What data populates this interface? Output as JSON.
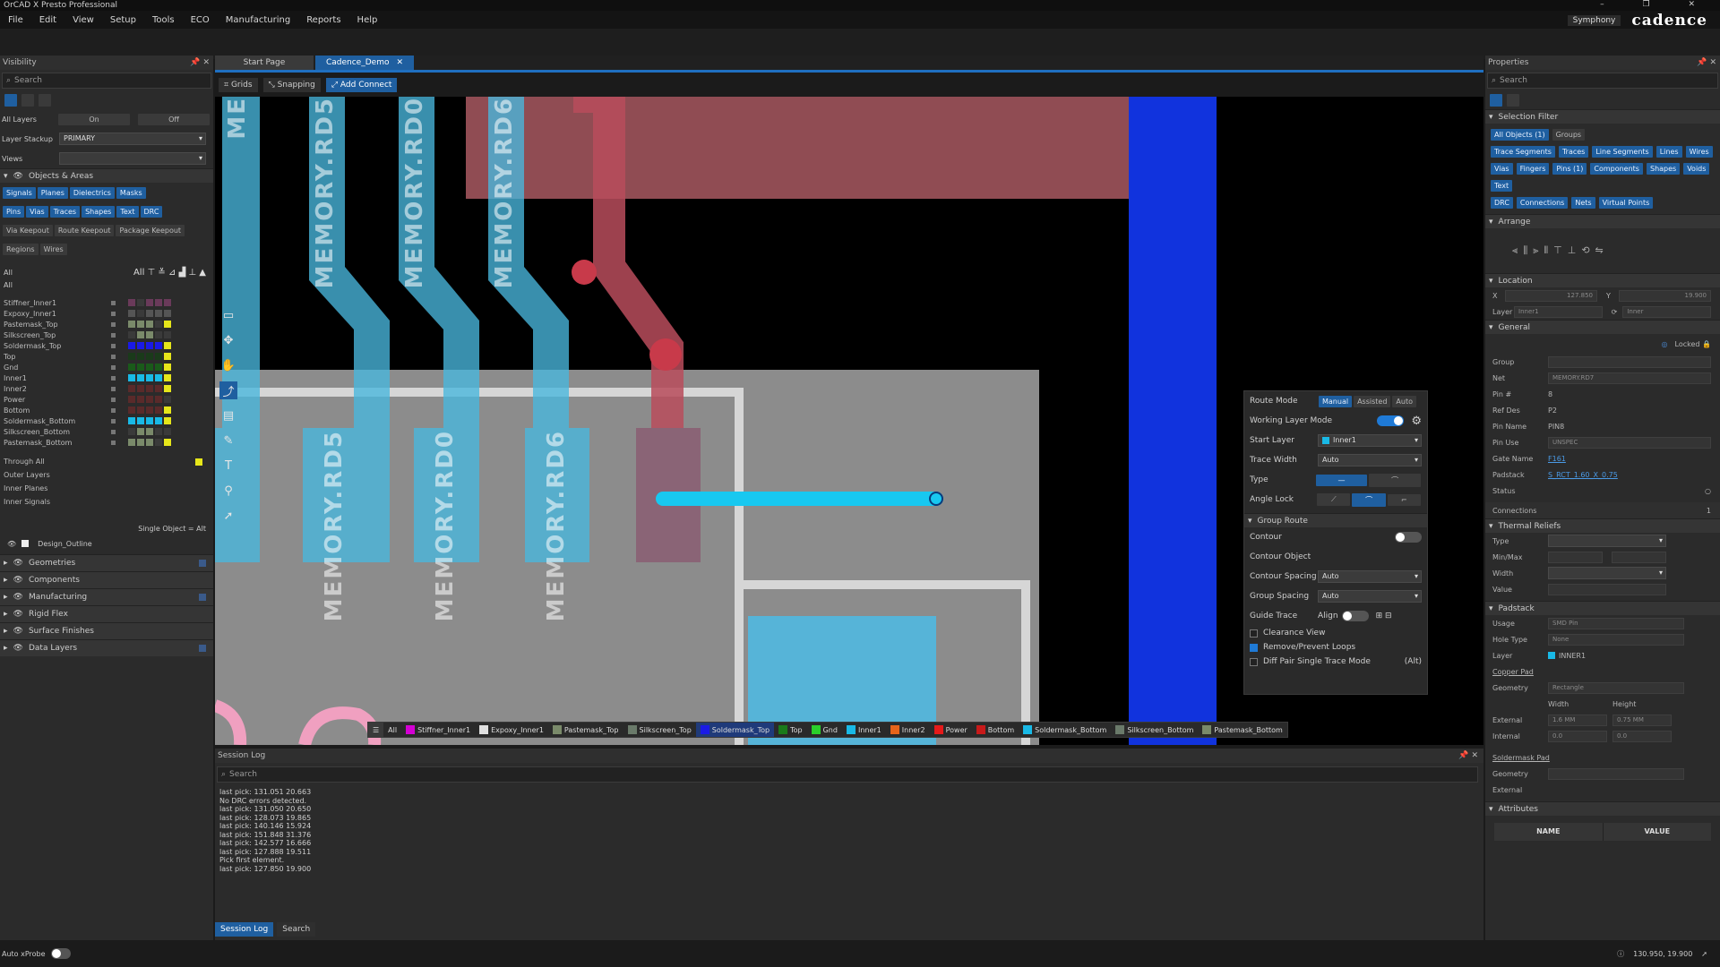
{
  "app": {
    "title": "OrCAD X Presto Professional"
  },
  "menu": [
    "File",
    "Edit",
    "View",
    "Setup",
    "Tools",
    "ECO",
    "Manufacturing",
    "Reports",
    "Help"
  ],
  "brand": {
    "symphony": "Symphony",
    "logo": "cadence"
  },
  "tabs": {
    "start": "Start Page",
    "design": "Cadence_Demo"
  },
  "toolbar": {
    "grids": "Grids",
    "snapping": "Snapping",
    "add_connect": "Add Connect"
  },
  "visibility": {
    "title": "Visibility",
    "search": "Search",
    "all_layers": "All Layers",
    "on": "On",
    "off": "Off",
    "layer_stackup_label": "Layer Stackup",
    "layer_stackup_value": "PRIMARY",
    "views_label": "Views",
    "objects_areas": "Objects & Areas",
    "groups1": [
      "Signals",
      "Planes",
      "Dielectrics",
      "Masks"
    ],
    "groups2": [
      "Pins",
      "Vias",
      "Traces",
      "Shapes",
      "Text",
      "DRC"
    ],
    "groups3": [
      "Via Keepout",
      "Route Keepout",
      "Package Keepout"
    ],
    "groups4": [
      "Regions",
      "Wires"
    ],
    "all": "All",
    "layers": [
      "Stiffner_Inner1",
      "Expoxy_Inner1",
      "Pastemask_Top",
      "Silkscreen_Top",
      "Soldermask_Top",
      "Top",
      "Gnd",
      "Inner1",
      "Inner2",
      "Power",
      "Bottom",
      "Soldermask_Bottom",
      "Silkscreen_Bottom",
      "Pastemask_Bottom"
    ],
    "extra": [
      "Through All",
      "Outer Layers",
      "Inner Planes",
      "Inner Signals"
    ],
    "single_object": "Single Object = Alt",
    "design_outline": "Design_Outline",
    "sections": [
      "Geometries",
      "Components",
      "Manufacturing",
      "Rigid Flex",
      "Surface Finishes",
      "Data Layers"
    ]
  },
  "canvas": {
    "labels": [
      "MEMORY.RD5",
      "MEMORY.RD0",
      "MEMORY.RD6",
      "MEMORY.RD5",
      "MEMORY.RD0",
      "MEMORY.RD6",
      "ME"
    ]
  },
  "route_panel": {
    "route_mode": "Route Mode",
    "modes": [
      "Manual",
      "Assisted",
      "Auto"
    ],
    "working_layer_mode": "Working Layer Mode",
    "start_layer": "Start Layer",
    "start_layer_value": "Inner1",
    "trace_width": "Trace Width",
    "trace_width_value": "Auto",
    "type": "Type",
    "angle_lock": "Angle Lock",
    "group_route": "Group Route",
    "contour": "Contour",
    "contour_object": "Contour Object",
    "contour_spacing": "Contour Spacing",
    "contour_spacing_value": "Auto",
    "group_spacing": "Group Spacing",
    "group_spacing_value": "Auto",
    "guide_trace": "Guide Trace",
    "align": "Align",
    "clearance_view": "Clearance View",
    "remove_loops": "Remove/Prevent Loops",
    "diff_pair": "Diff Pair Single Trace Mode",
    "alt": "(Alt)"
  },
  "layer_bar": {
    "all": "All",
    "items": [
      {
        "name": "Stiffner_Inner1",
        "color": "#d400d4"
      },
      {
        "name": "Expoxy_Inner1",
        "color": "#e0e0e0"
      },
      {
        "name": "Pastemask_Top",
        "color": "#7a8a6a"
      },
      {
        "name": "Silkscreen_Top",
        "color": "#6a7a6a"
      },
      {
        "name": "Soldermask_Top",
        "color": "#1a1ae6"
      },
      {
        "name": "Top",
        "color": "#1a7a1a"
      },
      {
        "name": "Gnd",
        "color": "#2acf2a"
      },
      {
        "name": "Inner1",
        "color": "#19b9e6"
      },
      {
        "name": "Inner2",
        "color": "#e6641a"
      },
      {
        "name": "Power",
        "color": "#e61a1a"
      },
      {
        "name": "Bottom",
        "color": "#c81a1a"
      },
      {
        "name": "Soldermask_Bottom",
        "color": "#19b9e6"
      },
      {
        "name": "Silkscreen_Bottom",
        "color": "#6a7a6a"
      },
      {
        "name": "Pastemask_Bottom",
        "color": "#7a8a6a"
      }
    ]
  },
  "session_log": {
    "title": "Session Log",
    "search": "Search",
    "lines": [
      "last pick: 131.051 20.663",
      "No DRC errors detected.",
      "last pick: 131.050 20.650",
      "last pick: 128.073 19.865",
      "last pick: 140.146 15.924",
      "last pick: 151.848 31.376",
      "last pick: 142.577 16.666",
      "last pick: 127.888 19.511",
      "Pick first element.",
      "last pick: 127.850 19.900"
    ],
    "tab_log": "Session Log",
    "tab_search": "Search"
  },
  "status": {
    "auto_xprobe": "Auto xProbe",
    "coords": "130.950, 19.900"
  },
  "properties": {
    "title": "Properties",
    "search": "Search",
    "selection_filter": "Selection Filter",
    "filters": [
      "All Objects (1)",
      "Groups",
      "Trace Segments",
      "Traces",
      "Line Segments",
      "Lines",
      "Wires",
      "Vias",
      "Fingers",
      "Pins (1)",
      "Components",
      "Shapes",
      "Voids",
      "Text",
      "DRC",
      "Connections",
      "Nets",
      "Virtual Points"
    ],
    "arrange": "Arrange",
    "location": "Location",
    "x": "X",
    "x_val": "127.850",
    "y": "Y",
    "y_val": "19.900",
    "layer": "Layer",
    "layer_val": "Inner1",
    "layer_val2": "Inner",
    "general": "General",
    "locked": "Locked",
    "group": "Group",
    "net": "Net",
    "net_val": "MEMORY.RD7",
    "pin_no": "Pin #",
    "pin_no_val": "8",
    "ref_des": "Ref Des",
    "ref_des_val": "P2",
    "pin_name": "Pin Name",
    "pin_name_val": "PIN8",
    "pin_use": "Pin Use",
    "pin_use_val": "UNSPEC",
    "gate_name": "Gate Name",
    "gate_name_val": "F161",
    "padstack": "Padstack",
    "padstack_val": "S_RCT_1.60_X_0.75",
    "status": "Status",
    "connections": "Connections",
    "connections_val": "1",
    "thermal_reliefs": "Thermal Reliefs",
    "type": "Type",
    "minmax": "Min/Max",
    "width": "Width",
    "value": "Value",
    "padstack_sec": "Padstack",
    "usage": "Usage",
    "usage_val": "SMD Pin",
    "hole_type": "Hole Type",
    "hole_type_val": "None",
    "ps_layer": "Layer",
    "ps_layer_val": "INNER1",
    "copper_pad": "Copper Pad",
    "geometry": "Geometry",
    "geometry_val": "Rectangle",
    "width_h": "Width",
    "height_h": "Height",
    "external": "External",
    "ext_w": "1.6 MM",
    "ext_h": "0.75 MM",
    "internal": "Internal",
    "int_w": "0.0",
    "int_h": "0.0",
    "soldermask_pad": "Soldermask Pad",
    "geometry2": "Geometry",
    "external2": "External",
    "attributes": "Attributes",
    "col_name": "NAME",
    "col_value": "VALUE"
  }
}
